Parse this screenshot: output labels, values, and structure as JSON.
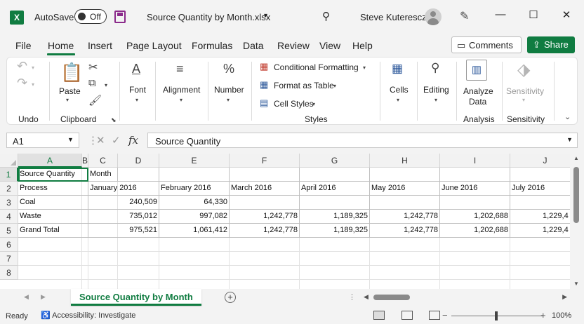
{
  "titlebar": {
    "logo": "X",
    "autosave_label": "AutoSave",
    "autosave_state": "Off",
    "doc_title": "Source Quantity by Month.xlsx",
    "user_name": "Steve Kuterescz",
    "minimize": "—",
    "maximize": "☐",
    "close": "✕"
  },
  "menu": {
    "tabs": [
      "File",
      "Home",
      "Insert",
      "Page Layout",
      "Formulas",
      "Data",
      "Review",
      "View",
      "Help"
    ],
    "active_tab": "Home",
    "comments_label": "Comments",
    "share_label": "Share"
  },
  "ribbon": {
    "undo_group": "Undo",
    "paste_label": "Paste",
    "clipboard_group": "Clipboard",
    "font_label": "Font",
    "alignment_label": "Alignment",
    "number_label": "Number",
    "conditional_formatting": "Conditional Formatting",
    "format_as_table": "Format as Table",
    "cell_styles": "Cell Styles",
    "styles_group": "Styles",
    "cells_label": "Cells",
    "editing_label": "Editing",
    "analyze_label_1": "Analyze",
    "analyze_label_2": "Data",
    "analysis_group": "Analysis",
    "sensitivity_label": "Sensitivity",
    "sensitivity_group": "Sensitivity"
  },
  "formula_bar": {
    "name_box": "A1",
    "fx": "fx",
    "content": "Source Quantity"
  },
  "grid": {
    "columns": [
      "A",
      "B",
      "C",
      "D",
      "E",
      "F",
      "G",
      "H",
      "I",
      "J"
    ],
    "rows": [
      "1",
      "2",
      "3",
      "4",
      "5",
      "6",
      "7",
      "8"
    ],
    "cells": {
      "r1": [
        "Source Quantity",
        "Month"
      ],
      "r2": [
        "Process",
        "January 2016",
        "February 2016",
        "March 2016",
        "April 2016",
        "May 2016",
        "June 2016",
        "July 2016"
      ],
      "r3": [
        "Coal",
        "240,509",
        "64,330"
      ],
      "r4": [
        "Waste",
        "735,012",
        "997,082",
        "1,242,778",
        "1,189,325",
        "1,242,778",
        "1,202,688",
        "1,229,4"
      ],
      "r5": [
        "Grand Total",
        "975,521",
        "1,061,412",
        "1,242,778",
        "1,189,325",
        "1,242,778",
        "1,202,688",
        "1,229,4"
      ]
    }
  },
  "sheets": {
    "active": "Source Quantity by Month"
  },
  "status": {
    "ready": "Ready",
    "accessibility": "Accessibility: Investigate",
    "zoom": "100%"
  }
}
